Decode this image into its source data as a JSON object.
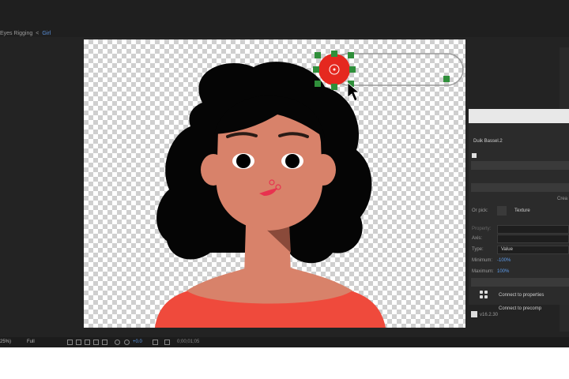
{
  "breadcrumb": {
    "parent": "Eyes Rigging",
    "separator": "<",
    "current": "Girl"
  },
  "duik_panel": {
    "title": "Duik Bassel.2",
    "create_label": "Crea",
    "or_pick_label": "Or pick:",
    "texture_label": "Texture",
    "property_label": "Property:",
    "axis_label": "Axis:",
    "type_label": "Type:",
    "type_value": "Value",
    "minimum_label": "Minimum:",
    "minimum_value": "-100%",
    "maximum_label": "Maximum:",
    "maximum_value": "100%",
    "connect_properties": "Connect to properties",
    "connect_precomp": "Connect to precomp",
    "version": "v16.2.30"
  },
  "toolbar": {
    "zoom": "25%)",
    "resolution": "Full",
    "exposure": "+0.0",
    "timecode": "0;00;01;05"
  },
  "colors": {
    "skin": "#d8826a",
    "hair": "#050505",
    "shirt": "#ef4a3c",
    "controller": "#e5281f",
    "handle": "#2f8f3a"
  }
}
